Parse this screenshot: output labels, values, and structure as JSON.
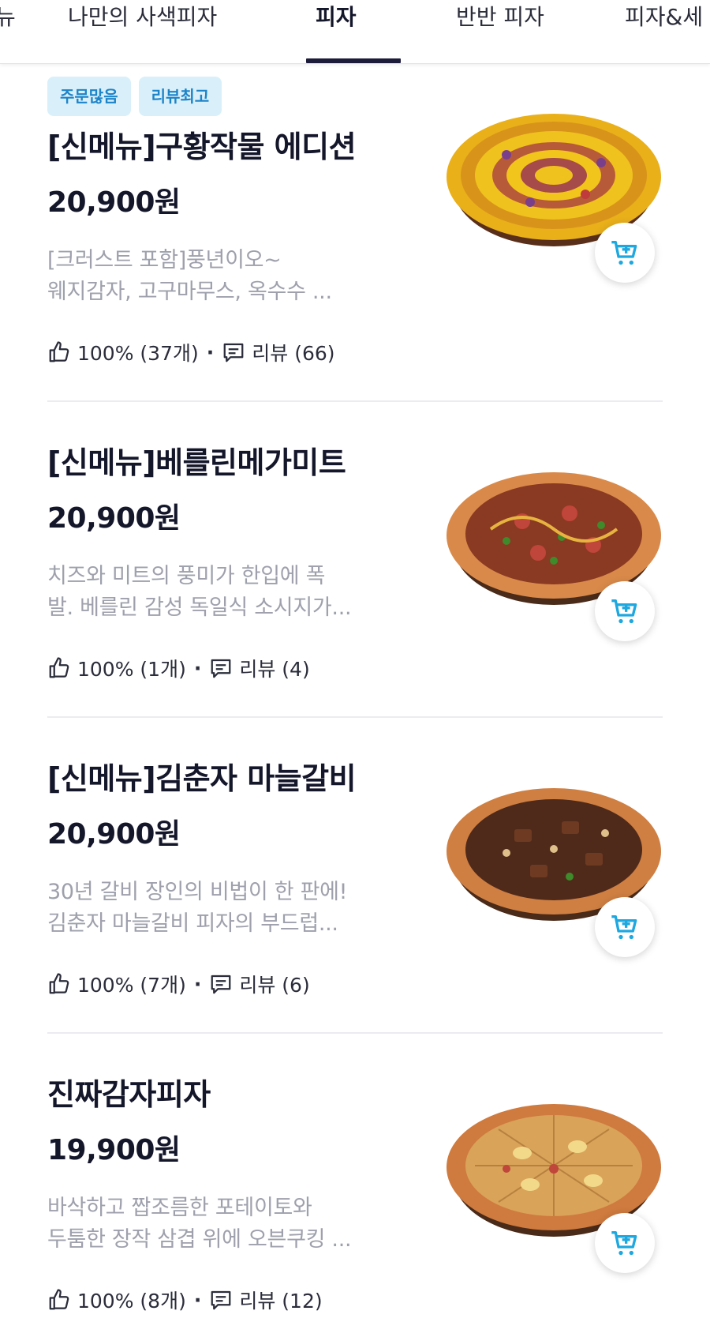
{
  "tabs": [
    {
      "label": "뉴",
      "active": false
    },
    {
      "label": "나만의 사색피자",
      "active": false
    },
    {
      "label": "피자",
      "active": true
    },
    {
      "label": "반반 피자",
      "active": false
    },
    {
      "label": "피자&세",
      "active": false
    }
  ],
  "colors": {
    "accent_tab_underline": "#1d1b3a",
    "badge_bg": "#d9f0fb",
    "badge_text": "#1e84c8",
    "cart_icon": "#1ea8e0",
    "description_text": "#9ea0ac"
  },
  "menu_items": [
    {
      "badges": [
        "주문많음",
        "리뷰최고"
      ],
      "title": "[신메뉴]구황작물 에디션",
      "price": "20,900원",
      "description_line1": "[크러스트 포함]풍년이오~",
      "description_line2": "웨지감자, 고구마무스, 옥수수 ...",
      "like_icon": "thumbs-up-icon",
      "like_text": "100% (37개)",
      "review_icon": "comment-icon",
      "review_text": "리뷰 (66)",
      "pizza_style": "corn",
      "cart_icon": "add-to-cart-icon"
    },
    {
      "badges": [],
      "title": "[신메뉴]베를린메가미트",
      "price": "20,900원",
      "description_line1": "치즈와 미트의 풍미가 한입에 폭",
      "description_line2": "발. 베를린 감성 독일식 소시지가...",
      "like_icon": "thumbs-up-icon",
      "like_text": "100% (1개)",
      "review_icon": "comment-icon",
      "review_text": "리뷰 (4)",
      "pizza_style": "meat",
      "cart_icon": "add-to-cart-icon"
    },
    {
      "badges": [],
      "title": "[신메뉴]김춘자 마늘갈비",
      "price": "20,900원",
      "description_line1": "30년 갈비 장인의 비법이 한 판에!",
      "description_line2": "김춘자 마늘갈비 피자의 부드럽...",
      "like_icon": "thumbs-up-icon",
      "like_text": "100% (7개)",
      "review_icon": "comment-icon",
      "review_text": "리뷰 (6)",
      "pizza_style": "galbi",
      "cart_icon": "add-to-cart-icon"
    },
    {
      "badges": [],
      "title": "진짜감자피자",
      "price": "19,900원",
      "description_line1": "바삭하고 짭조름한 포테이토와",
      "description_line2": "두툼한 장작 삼겹 위에 오븐쿠킹 ...",
      "like_icon": "thumbs-up-icon",
      "like_text": "100% (8개)",
      "review_icon": "comment-icon",
      "review_text": "리뷰 (12)",
      "pizza_style": "potato",
      "cart_icon": "add-to-cart-icon"
    }
  ]
}
